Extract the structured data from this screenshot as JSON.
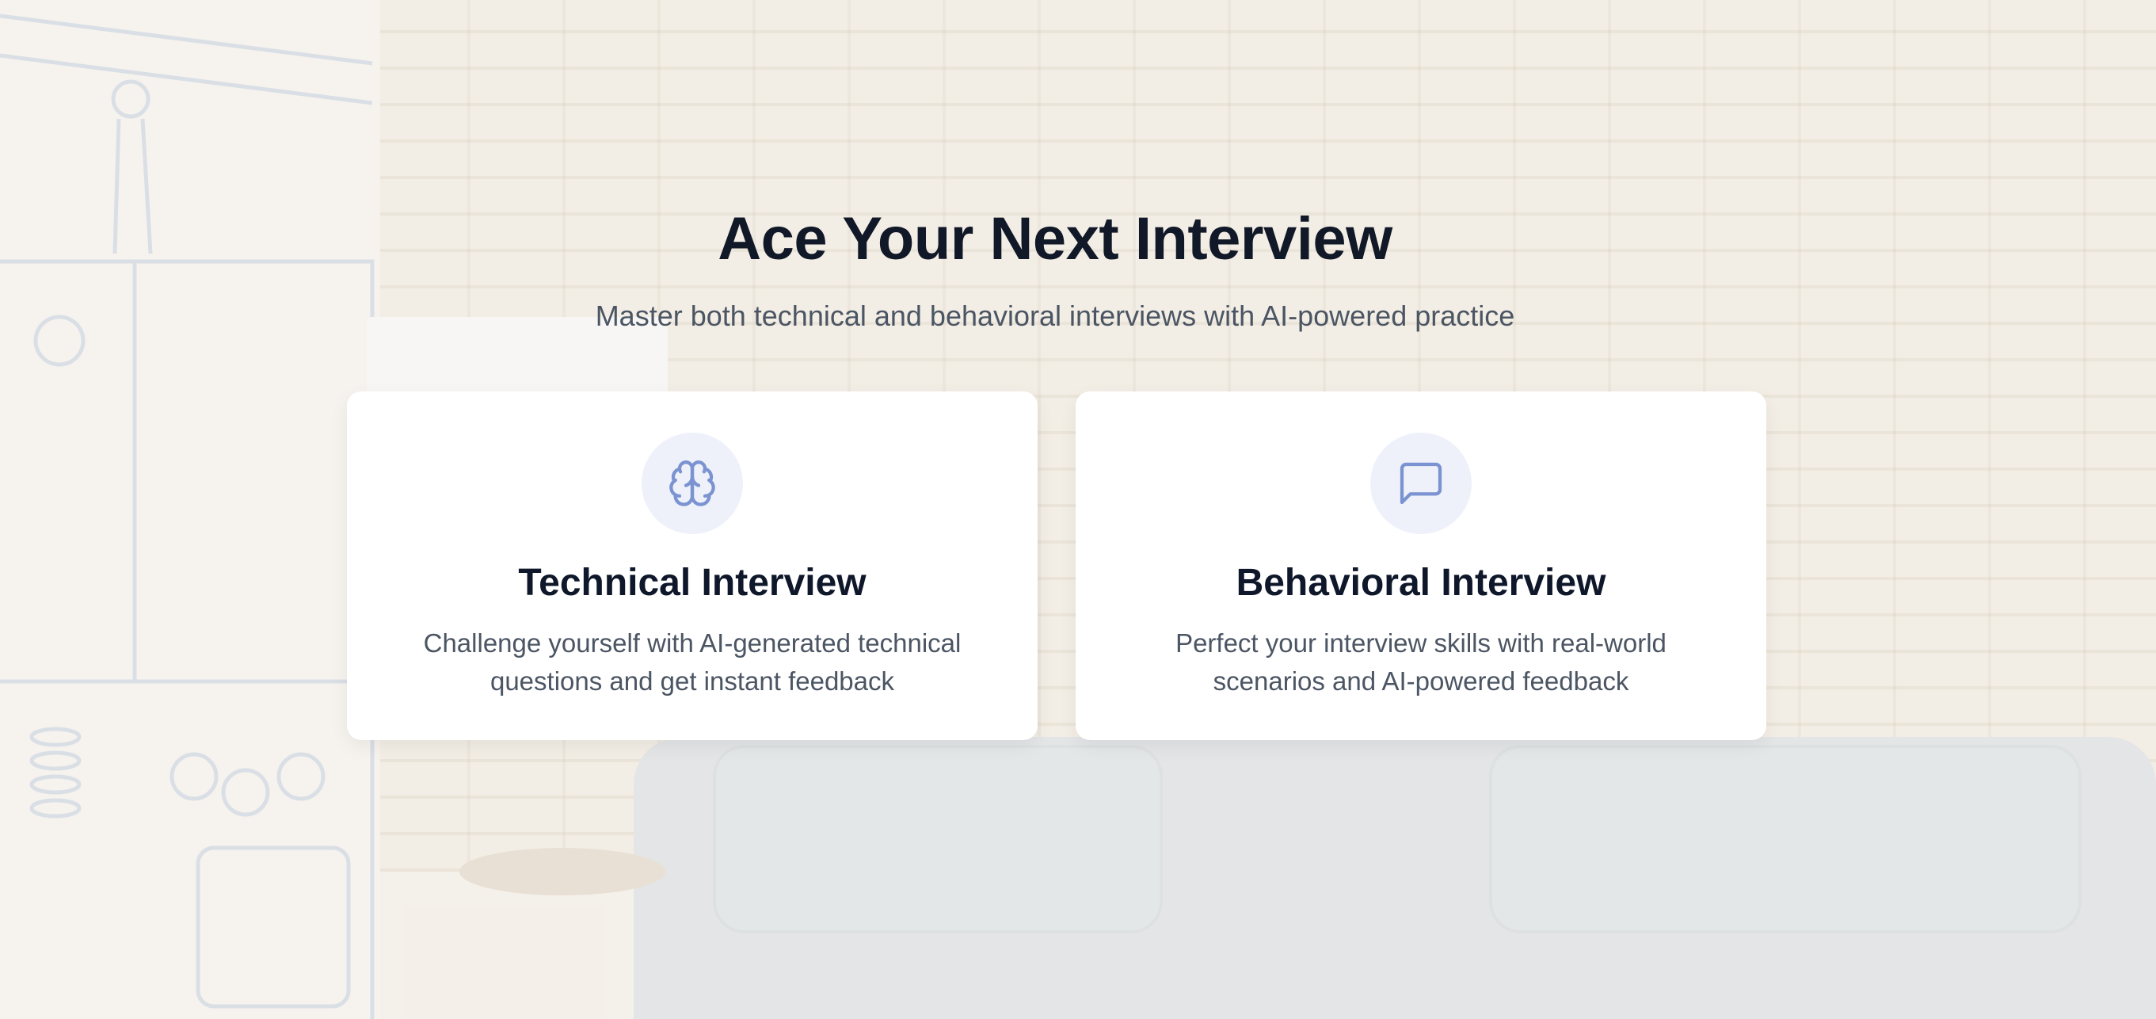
{
  "hero": {
    "title": "Ace Your Next Interview",
    "subtitle": "Master both technical and behavioral interviews with AI-powered practice"
  },
  "cards": [
    {
      "title": "Technical Interview",
      "description": "Challenge yourself with AI-generated technical questions and get instant feedback",
      "icon": "brain-icon"
    },
    {
      "title": "Behavioral Interview",
      "description": "Perfect your interview skills with real-world scenarios and AI-powered feedback",
      "icon": "message-square-icon"
    }
  ],
  "colors": {
    "accent": "#7b93d1",
    "icon_bg": "#eef1fa",
    "heading": "#111827",
    "body_text": "#4b5563",
    "card_bg": "#ffffff"
  }
}
